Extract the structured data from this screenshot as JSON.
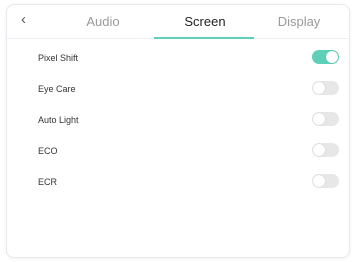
{
  "header": {
    "back_icon": "‹",
    "tabs": [
      {
        "label": "Audio",
        "active": false
      },
      {
        "label": "Screen",
        "active": true
      },
      {
        "label": "Display",
        "active": false
      }
    ]
  },
  "settings": [
    {
      "label": "Pixel Shift",
      "enabled": true
    },
    {
      "label": "Eye Care",
      "enabled": false
    },
    {
      "label": "Auto Light",
      "enabled": false
    },
    {
      "label": "ECO",
      "enabled": false
    },
    {
      "label": "ECR",
      "enabled": false
    }
  ],
  "colors": {
    "accent": "#5ecfb8",
    "toggle_off": "#e7e7e7",
    "tab_inactive": "#9a9a9a",
    "tab_active": "#222222"
  }
}
